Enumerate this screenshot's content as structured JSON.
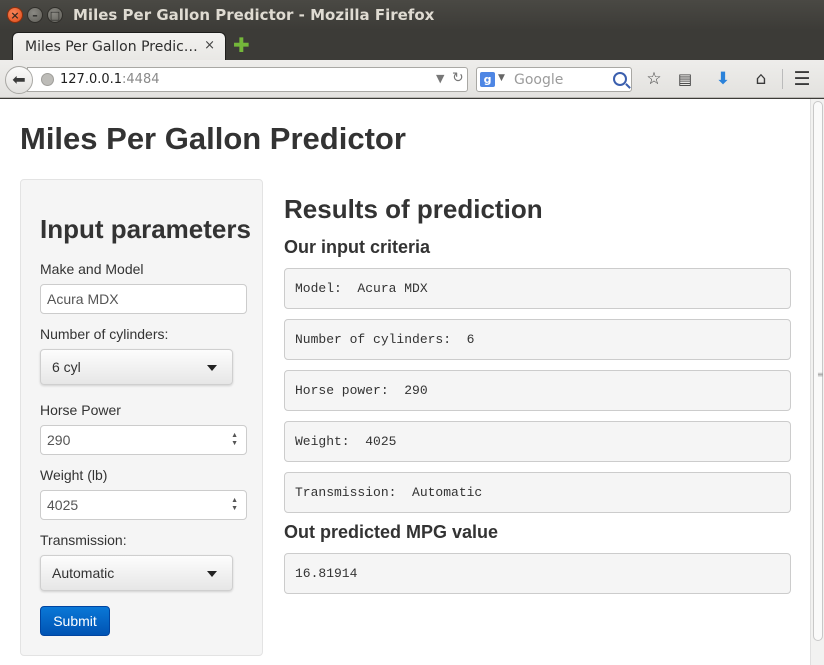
{
  "window": {
    "title": "Miles Per Gallon Predictor - Mozilla Firefox",
    "close_glyph": "×",
    "minimize_glyph": "–",
    "maximize_glyph": "□"
  },
  "tab": {
    "label": "Miles Per Gallon Predic…",
    "close_glyph": "×",
    "new_tab_glyph": "✚"
  },
  "navbar": {
    "url_host": "127.0.0.1",
    "url_port": ":4484",
    "search_placeholder": "Google",
    "search_engine_glyph": "g"
  },
  "page": {
    "title": "Miles Per Gallon Predictor",
    "sidebar": {
      "heading": "Input parameters",
      "make_model_label": "Make and Model",
      "make_model_value": "Acura MDX",
      "cylinders_label": "Number of cylinders:",
      "cylinders_value": "6 cyl",
      "horsepower_label": "Horse Power",
      "horsepower_value": "290",
      "weight_label": "Weight (lb)",
      "weight_value": "4025",
      "transmission_label": "Transmission:",
      "transmission_value": "Automatic",
      "submit_label": "Submit"
    },
    "results": {
      "heading": "Results of prediction",
      "criteria_heading": "Our input criteria",
      "criteria": [
        "Model:  Acura MDX",
        "Number of cylinders:  6",
        "Horse power:  290",
        "Weight:  4025",
        "Transmission:  Automatic"
      ],
      "prediction_heading": "Out predicted MPG value",
      "prediction_value": "16.81914"
    }
  },
  "colors": {
    "submit_button": "#0a6fd1",
    "title_bar": "#3c3b37",
    "close_button": "#e0541f"
  }
}
